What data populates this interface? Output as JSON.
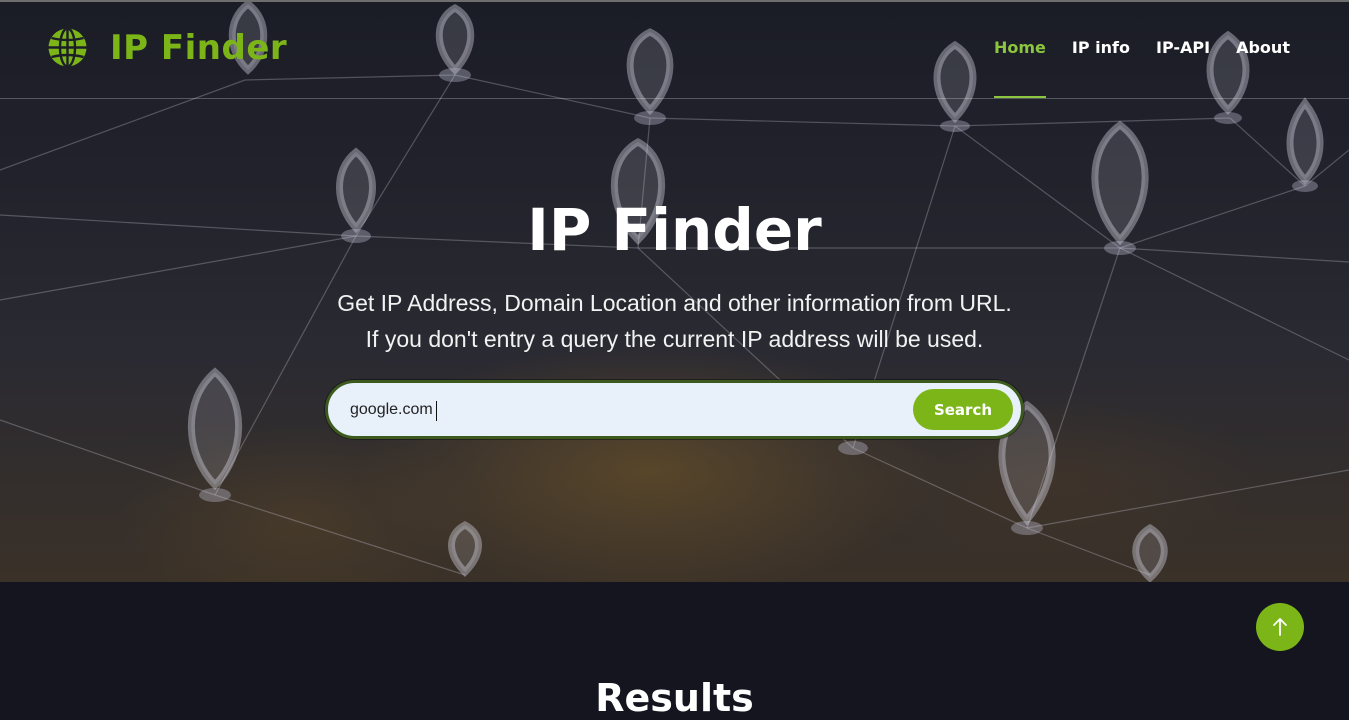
{
  "header": {
    "brand": "IP Finder",
    "logo_icon": "globe-icon",
    "nav": [
      {
        "label": "Home",
        "active": true
      },
      {
        "label": "IP info",
        "active": false
      },
      {
        "label": "IP-API",
        "active": false
      },
      {
        "label": "About",
        "active": false
      }
    ]
  },
  "hero": {
    "title": "IP Finder",
    "subtitle_line1": "Get IP Address, Domain Location and other information from URL.",
    "subtitle_line2": "If you don't entry a query the current IP address will be used."
  },
  "search": {
    "value": "google.com",
    "button_label": "Search"
  },
  "results": {
    "heading": "Results"
  },
  "back_to_top_icon": "arrow-up-icon",
  "colors": {
    "accent": "#7cb518",
    "nav_active": "#8cc63f",
    "page_bg": "#15151f"
  }
}
